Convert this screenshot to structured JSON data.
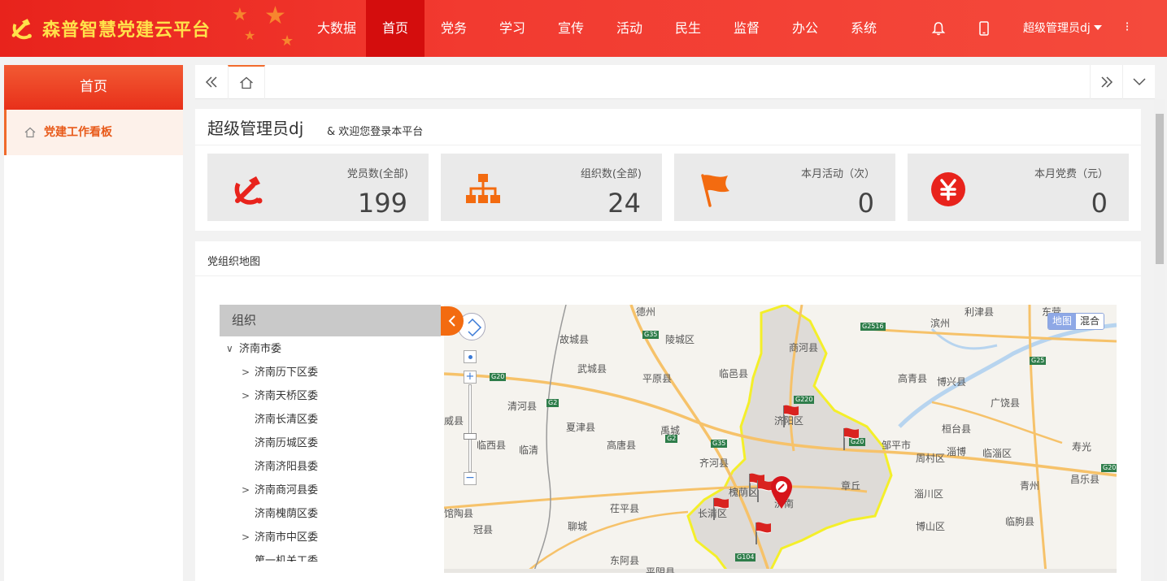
{
  "header": {
    "brand_title": "森普智慧党建云平台",
    "nav": [
      {
        "label": "大数据",
        "active": false
      },
      {
        "label": "首页",
        "active": true
      },
      {
        "label": "党务",
        "active": false
      },
      {
        "label": "学习",
        "active": false
      },
      {
        "label": "宣传",
        "active": false
      },
      {
        "label": "活动",
        "active": false
      },
      {
        "label": "民生",
        "active": false
      },
      {
        "label": "监督",
        "active": false
      },
      {
        "label": "办公",
        "active": false
      },
      {
        "label": "系统",
        "active": false
      }
    ],
    "user_name": "超级管理员dj",
    "icons": [
      "bell-icon",
      "mobile-icon",
      "more-vertical-icon"
    ]
  },
  "sidebar": {
    "title": "首页",
    "items": [
      {
        "label": "党建工作看板",
        "icon": "home-icon",
        "active": true
      }
    ]
  },
  "tabbar": {
    "icons": [
      "double-left-icon",
      "home-icon",
      "double-right-icon",
      "chevron-down-icon"
    ]
  },
  "welcome": {
    "user": "超级管理员dj",
    "message": "& 欢迎您登录本平台"
  },
  "stats": [
    {
      "label": "党员数(全部)",
      "value": "199",
      "icon": "party-emblem-icon",
      "color": "#e8231c"
    },
    {
      "label": "组织数(全部)",
      "value": "24",
      "icon": "org-chart-icon",
      "color": "#f36b10"
    },
    {
      "label": "本月活动（次）",
      "value": "0",
      "icon": "flag-icon",
      "color": "#f36b10"
    },
    {
      "label": "本月党费（元）",
      "value": "0",
      "icon": "yuan-icon",
      "color": "#e8231c"
    }
  ],
  "org_map": {
    "title": "党组织地图",
    "panel_title": "组织",
    "tree": [
      {
        "label": "济南市委",
        "level": 0,
        "expanded": true,
        "has_children": true
      },
      {
        "label": "济南历下区委",
        "level": 1,
        "has_children": true
      },
      {
        "label": "济南天桥区委",
        "level": 1,
        "has_children": true
      },
      {
        "label": "济南长清区委",
        "level": 1,
        "has_children": false
      },
      {
        "label": "济南历城区委",
        "level": 1,
        "has_children": false
      },
      {
        "label": "济南济阳县委",
        "level": 1,
        "has_children": false
      },
      {
        "label": "济南商河县委",
        "level": 1,
        "has_children": true
      },
      {
        "label": "济南槐荫区委",
        "level": 1,
        "has_children": false
      },
      {
        "label": "济南市中区委",
        "level": 1,
        "has_children": true
      },
      {
        "label": "第一机关工委",
        "level": 1,
        "has_children": false
      }
    ],
    "map_types": [
      "地图",
      "混合"
    ],
    "map_type_selected": "地图",
    "place_labels": [
      "德州",
      "利津县",
      "东营",
      "故城县",
      "陵城区",
      "商河县",
      "滨州",
      "武城县",
      "临邑县",
      "高青县",
      "博兴县",
      "平原县",
      "济阳区",
      "广饶县",
      "清河县",
      "夏津县",
      "禹城",
      "邹平市",
      "桓台县",
      "临西县",
      "临清",
      "高唐县",
      "齐河县",
      "周村区",
      "淄博",
      "临淄区",
      "寿光",
      "槐荫区",
      "济南",
      "章丘",
      "淄川区",
      "青州",
      "昌乐县",
      "长清区",
      "茌平县",
      "博山区",
      "临朐县",
      "聊城",
      "冠县",
      "东阿县",
      "平阴县",
      "威县",
      "馆陶县"
    ],
    "road_labels": [
      "G35",
      "G2516",
      "G25",
      "G20",
      "G2",
      "G220",
      "G20",
      "G2",
      "G35",
      "G104",
      "G20"
    ]
  },
  "colors": {
    "header_red": "#e8231c",
    "nav_active": "#d40d0d",
    "accent_orange": "#f36b10",
    "brand_yellow": "#ffe14a"
  }
}
